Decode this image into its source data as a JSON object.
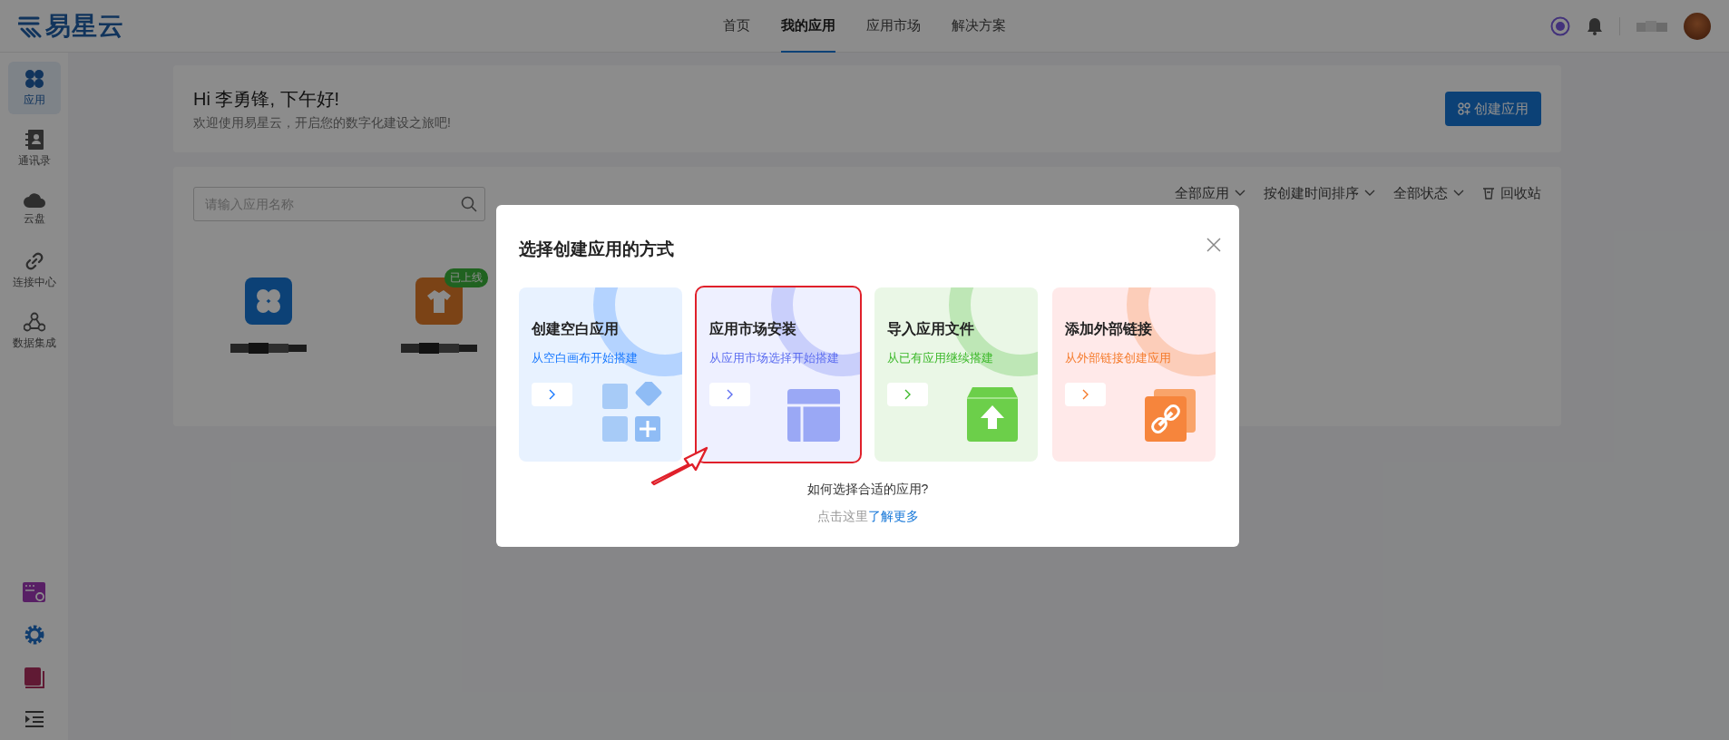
{
  "logo": {
    "text": "易星云"
  },
  "nav": [
    {
      "label": "首页",
      "selected": false
    },
    {
      "label": "我的应用",
      "selected": true
    },
    {
      "label": "应用市场",
      "selected": false
    },
    {
      "label": "解决方案",
      "selected": false
    }
  ],
  "sidebar": {
    "items": [
      {
        "label": "应用",
        "selected": true
      },
      {
        "label": "通讯录",
        "selected": false
      },
      {
        "label": "云盘",
        "selected": false
      },
      {
        "label": "连接中心",
        "selected": false
      },
      {
        "label": "数据集成",
        "selected": false
      }
    ]
  },
  "greeting": {
    "title": "Hi  李勇锋, 下午好!",
    "subtitle": "欢迎使用易星云，开启您的数字化建设之旅吧!"
  },
  "create_button": {
    "label": "创建应用"
  },
  "search": {
    "placeholder": "请输入应用名称"
  },
  "filters": [
    {
      "label": "全部应用"
    },
    {
      "label": "按创建时间排序"
    },
    {
      "label": "全部状态"
    }
  ],
  "recycle_bin": {
    "label": "回收站"
  },
  "apps": [
    {
      "kind": "clover"
    },
    {
      "kind": "shirt",
      "badge": "已上线"
    }
  ],
  "modal": {
    "title": "选择创建应用的方式",
    "options": [
      {
        "kind": "blank",
        "title": "创建空白应用",
        "subtitle": "从空白画布开始搭建",
        "color": "#1677ff",
        "highlighted": false
      },
      {
        "kind": "market",
        "title": "应用市场安装",
        "subtitle": "从应用市场选择开始搭建",
        "color": "#5b6cf0",
        "highlighted": true
      },
      {
        "kind": "import",
        "title": "导入应用文件",
        "subtitle": "从已有应用继续搭建",
        "color": "#3bb829",
        "highlighted": false
      },
      {
        "kind": "link",
        "title": "添加外部链接",
        "subtitle": "从外部链接创建应用",
        "color": "#f57a2a",
        "highlighted": false
      }
    ],
    "help_question": "如何选择合适的应用?",
    "help_prefix": "点击这里",
    "help_link": "了解更多"
  }
}
